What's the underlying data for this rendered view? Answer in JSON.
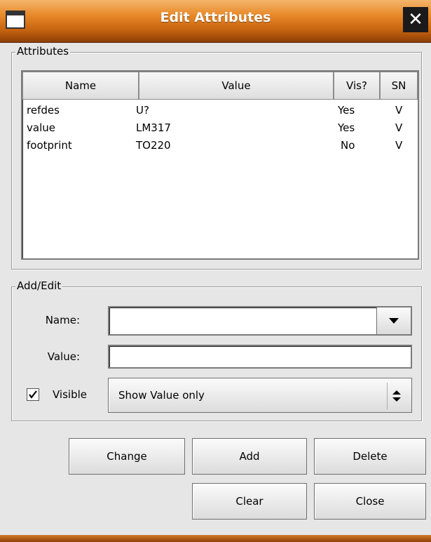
{
  "window": {
    "title": "Edit Attributes"
  },
  "attributes": {
    "frame_label": "Attributes",
    "columns": [
      "Name",
      "Value",
      "Vis?",
      "SN"
    ],
    "rows": [
      {
        "name": "refdes",
        "value": "U?",
        "vis": "Yes",
        "sn": "V"
      },
      {
        "name": "value",
        "value": "LM317",
        "vis": "Yes",
        "sn": "V"
      },
      {
        "name": "footprint",
        "value": "TO220",
        "vis": "No",
        "sn": "V"
      }
    ]
  },
  "add_edit": {
    "frame_label": "Add/Edit",
    "name_label": "Name:",
    "name_value": "",
    "value_label": "Value:",
    "value_value": "",
    "visible_label": "Visible",
    "visible_checked": true,
    "show_option": "Show Value only"
  },
  "buttons": {
    "change": "Change",
    "add": "Add",
    "delete": "Delete",
    "clear": "Clear",
    "close": "Close"
  }
}
